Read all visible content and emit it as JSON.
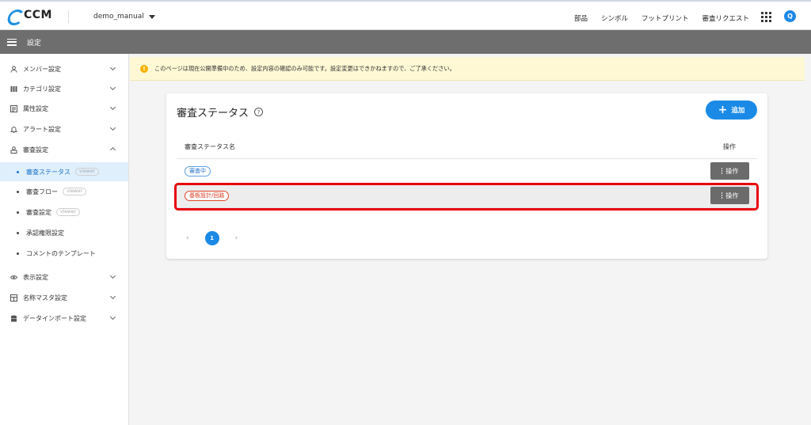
{
  "header": {
    "logo_text": "CCM",
    "project": "demo_manual",
    "nav": [
      "部品",
      "シンボル",
      "フットプリント",
      "審査リクエスト"
    ],
    "avatar_letter": "Q"
  },
  "titlebar": {
    "title": "設定"
  },
  "sidebar": {
    "items": [
      {
        "label": "メンバー設定",
        "icon": "person-icon"
      },
      {
        "label": "カテゴリ設定",
        "icon": "category-icon"
      },
      {
        "label": "属性設定",
        "icon": "attribute-icon"
      },
      {
        "label": "アラート設定",
        "icon": "bell-icon"
      },
      {
        "label": "審査設定",
        "icon": "review-icon"
      }
    ],
    "sub_items": [
      {
        "label": "審査ステータス",
        "badge": "viewer"
      },
      {
        "label": "審査フロー",
        "badge": "viewer"
      },
      {
        "label": "審査設定",
        "badge": "viewer"
      },
      {
        "label": "承認権限設定",
        "badge": ""
      },
      {
        "label": "コメントのテンプレート",
        "badge": ""
      }
    ],
    "lower_items": [
      {
        "label": "表示設定",
        "icon": "eye-icon"
      },
      {
        "label": "名称マスタ設定",
        "icon": "table-icon"
      },
      {
        "label": "データインポート設定",
        "icon": "database-icon"
      }
    ]
  },
  "banner": {
    "text": "このページは現在公開準備中のため、設定内容の確認のみ可能です。設定変更はできかねますので、ご了承ください。"
  },
  "card": {
    "title": "審査ステータス",
    "add_label": "追加",
    "columns": [
      "審査ステータス名",
      "操作"
    ],
    "rows": [
      {
        "status": "審査中",
        "color": "#2b75c9",
        "action": "操作"
      },
      {
        "status": "基板設計/回路",
        "color": "#d8391f",
        "action": "操作"
      }
    ],
    "pagination": {
      "current": "1",
      "prev": "‹",
      "next": "›"
    }
  },
  "colors": {
    "accent": "#1a8ae6",
    "highlight": "#e8000b",
    "titlebar": "#6e6e6e",
    "banner": "#fff8d5"
  }
}
